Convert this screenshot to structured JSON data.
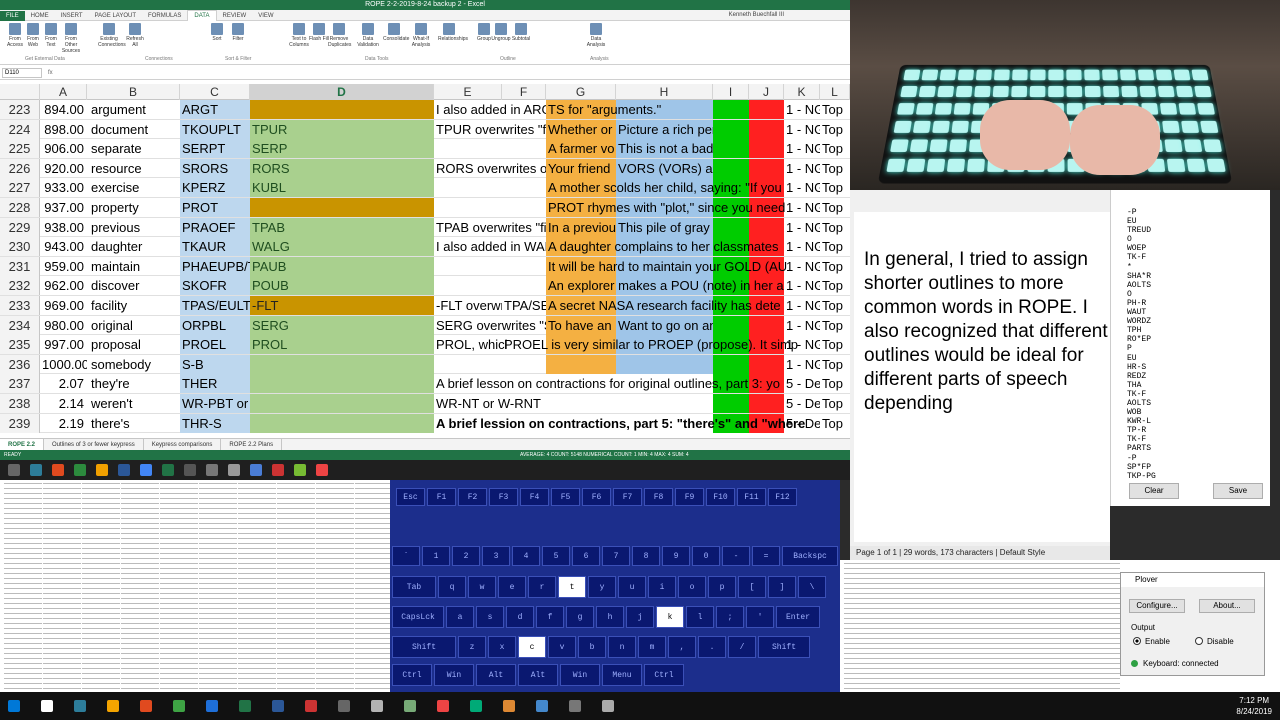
{
  "excel": {
    "title": "ROPE 2-2-2019-8-24 backup 2 - Excel",
    "tabs": [
      "FILE",
      "HOME",
      "INSERT",
      "PAGE LAYOUT",
      "FORMULAS",
      "DATA",
      "REVIEW",
      "VIEW"
    ],
    "user": "Kenneth Buechfall III",
    "ribbon_buttons": [
      "From Access",
      "From Web",
      "From Text",
      "From Other Sources",
      "Existing Connections",
      "Refresh All",
      "Sort",
      "Filter",
      "Text to Columns",
      "Flash Fill",
      "Remove Duplicates",
      "Data Validation",
      "Consolidate",
      "What-If Analysis",
      "Relationships",
      "Group",
      "Ungroup",
      "Subtotal",
      "Data Analysis"
    ],
    "ribbon_groups": [
      "Get External Data",
      "Connections",
      "Sort & Filter",
      "Data Tools",
      "Outline",
      "Analysis"
    ],
    "name_box": "D110",
    "fx": "fx",
    "columns": [
      "A",
      "B",
      "C",
      "D",
      "E",
      "F",
      "G",
      "H",
      "I",
      "J",
      "K",
      "L"
    ],
    "rows": [
      {
        "n": "223",
        "a": "894.00",
        "b": "argument",
        "c": "ARGT",
        "d": "",
        "d_orange": true,
        "e": "I also added in ARGT",
        "g": "TS for \"arguments.\""
      },
      {
        "n": "224",
        "a": "898.00",
        "b": "document",
        "c": "TKOUPLT",
        "d": "TPUR",
        "e": "TPUR overwrites \"f",
        "g": "Whether or",
        "h": "Picture a rich person enjoying"
      },
      {
        "n": "225",
        "a": "906.00",
        "b": "separate",
        "c": "SERPT",
        "d": "SERP",
        "g": "A farmer vo",
        "h": "This is not a bad idea to stay sep"
      },
      {
        "n": "226",
        "a": "920.00",
        "b": "resource",
        "c": "SRORS",
        "d": "RORS",
        "e": "RORS overwrites or",
        "g": "Your friend",
        "h": "VORS (VORs) are an importar"
      },
      {
        "n": "227",
        "a": "933.00",
        "b": "exercise",
        "c": "KPERZ",
        "d": "KUBL",
        "g": "A mother scolds her child, saying: \"If you"
      },
      {
        "n": "228",
        "a": "937.00",
        "b": "property",
        "c": "PROT",
        "d": "",
        "d_orange": true,
        "g": "PROT rhymes with \"plot,\" since you need"
      },
      {
        "n": "229",
        "a": "938.00",
        "b": "previous",
        "c": "PRAOEF",
        "d": "TPAB",
        "e": "TPAB overwrites \"fi",
        "g": "In a previou",
        "h": "This pile of gray stone was a"
      },
      {
        "n": "230",
        "a": "943.00",
        "b": "daughter",
        "c": "TKAUR",
        "d": "WALG",
        "e": "I also added in WAL",
        "g": "A daughter complains to her classmates"
      },
      {
        "n": "231",
        "a": "959.00",
        "b": "maintain",
        "c": "PHAEUPB/T",
        "d": "PAUB",
        "g": "It will be hard to maintain your GOLD (AU"
      },
      {
        "n": "232",
        "a": "962.00",
        "b": "discover",
        "c": "SKOFR",
        "d": "POUB",
        "g": "An explorer makes a POU (note) in her a"
      },
      {
        "n": "233",
        "a": "969.00",
        "b": "facility",
        "c": "TPAS/EULT",
        "d": "-FLT",
        "d_orange": true,
        "e": "-FLT overwr",
        "f": "TPA/SE",
        "g": "A secret NASA research facility has dete"
      },
      {
        "n": "234",
        "a": "980.00",
        "b": "original",
        "c": "ORPBL",
        "d": "SERG",
        "e": "SERG overwrites \"S",
        "g": "To have an",
        "h": "Want to go on an original vac"
      },
      {
        "n": "235",
        "a": "997.00",
        "b": "proposal",
        "c": "PROEL",
        "d": "PROL",
        "e": "PROL, whicl",
        "f": "PROEL is very similar to PROEP (propose). It simp"
      },
      {
        "n": "236",
        "a": "1000.00",
        "b": "somebody",
        "c": "S-B",
        "d": ""
      },
      {
        "n": "237",
        "a": "2.07",
        "b": "they're",
        "c": "THER",
        "d": "",
        "e": "A brief lesson on contractions for original outlines, part 3: yo"
      },
      {
        "n": "238",
        "a": "2.14",
        "b": "weren't",
        "c": "WR-PBT or W-RPBT",
        "d": "",
        "e": "WR-NT or W-RNT"
      },
      {
        "n": "239",
        "a": "2.19",
        "b": "there's",
        "c": "THR-S",
        "d": "",
        "e": "A brief lession on contractions, part 5: \"there's\" and \"where"
      }
    ],
    "col_i": "1 - NG",
    "col_i_alt": "5 - Der",
    "col_l": "Top",
    "sheet_tabs": [
      "ROPE 2.2",
      "Outlines of 3 or fewer keypress",
      "Keypress comparisons",
      "ROPE 2.2 Plans"
    ],
    "status": "READY",
    "status_stats": "AVERAGE: 4    COUNT: 5148    NUMERICAL COUNT: 1    MIN: 4    MAX: 4    SUM: 4"
  },
  "word": {
    "text": "In general, I tried to assign shorter outlines to more common words in ROPE. I also recognized that different outlines would be ideal for different parts of speech depending",
    "status": "Page 1 of 1 | 29 words, 173 characters | Default Style"
  },
  "paper_tape": {
    "lines": [
      "-P",
      "EU",
      "TREUD",
      "O",
      "WOEP",
      "TK-F",
      "*",
      "SHA*R",
      "AOLTS",
      "O",
      "PH-R",
      "WAUT",
      "WORDZ",
      "TPH",
      "RO*EP",
      "P",
      "EU",
      "HR-S",
      "REDZ",
      "THA",
      "TK-F",
      "AOLTS",
      "WOB",
      "KWR-L",
      "TP-R",
      "TK-F",
      "PARTS",
      "-P",
      "SP*FP",
      "TKP-PG"
    ],
    "clear_label": "Clear",
    "save_label": "Save"
  },
  "steno_keyboard": {
    "fkeys": [
      "Esc",
      "F1",
      "F2",
      "F3",
      "F4",
      "F5",
      "F6",
      "F7",
      "F8",
      "F9",
      "F10",
      "F11",
      "F12"
    ],
    "num_row": [
      "`",
      "1",
      "2",
      "3",
      "4",
      "5",
      "6",
      "7",
      "8",
      "9",
      "0",
      "-",
      "=",
      "Backspc"
    ],
    "tab_row": [
      "Tab",
      "q",
      "w",
      "e",
      "r",
      "t",
      "y",
      "u",
      "i",
      "o",
      "p",
      "[",
      "]",
      "\\"
    ],
    "caps_row": [
      "CapsLck",
      "a",
      "s",
      "d",
      "f",
      "g",
      "h",
      "j",
      "k",
      "l",
      ";",
      "'",
      "Enter"
    ],
    "shift_row": [
      "Shift",
      "z",
      "x",
      "c",
      "v",
      "b",
      "n",
      "m",
      ",",
      ".",
      "/",
      "Shift"
    ],
    "bottom_row": [
      "Ctrl",
      "Win",
      "Alt",
      "Alt",
      "Win",
      "Menu",
      "Ctrl"
    ],
    "highlighted": [
      "c",
      "t",
      "k"
    ]
  },
  "plover": {
    "title": "Plover",
    "configure_label": "Configure...",
    "about_label": "About...",
    "output_label": "Output",
    "enable_label": "Enable",
    "disable_label": "Disable",
    "status": "Keyboard: connected"
  },
  "clock": {
    "time": "7:12 PM",
    "date": "8/24/2019"
  },
  "colors": {
    "excel_green": "#217346",
    "steno_blue": "#1c2e8c"
  }
}
